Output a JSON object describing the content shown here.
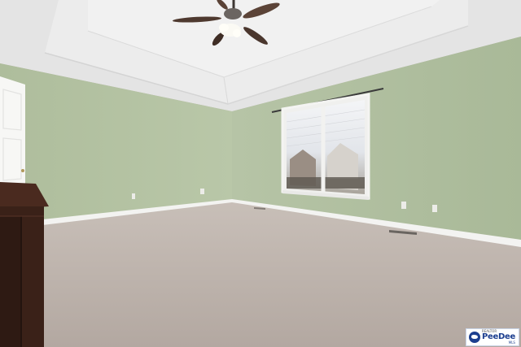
{
  "photo": {
    "subject": "empty carpeted bedroom",
    "colors": {
      "wall": "#b3c2a2",
      "ceiling": "#e6e6e6",
      "carpet": "#bcb2ab",
      "trim": "#f4f4f2",
      "dresser": "#3a2118"
    }
  },
  "watermark": {
    "top": "REALTOR",
    "name": "PeeDee",
    "suffix": "MLS"
  }
}
